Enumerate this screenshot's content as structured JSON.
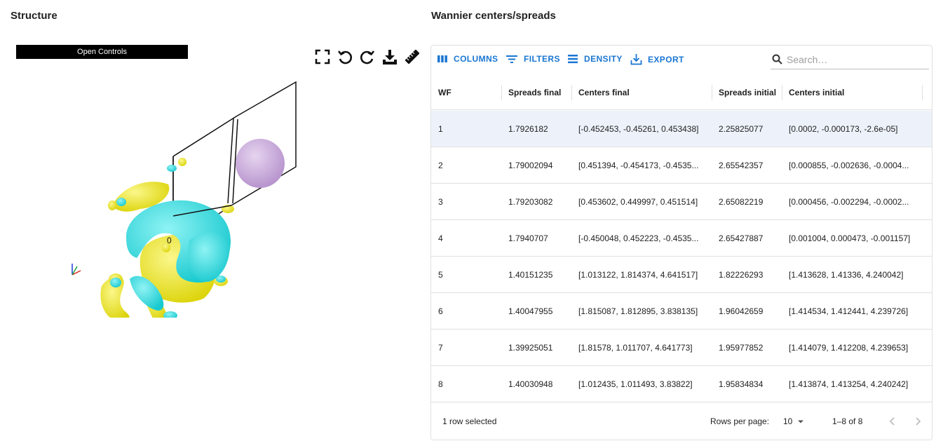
{
  "left": {
    "title": "Structure",
    "open_controls": "Open Controls",
    "axis_label": "0",
    "tools": [
      "fullscreen-icon",
      "rotate-left-icon",
      "rotate-right-icon",
      "download-icon",
      "ruler-icon"
    ]
  },
  "right": {
    "title": "Wannier centers/spreads",
    "toolbar": {
      "columns": "COLUMNS",
      "filters": "FILTERS",
      "density": "DENSITY",
      "export": "EXPORT",
      "search_placeholder": "Search…"
    },
    "columns": [
      "WF",
      "Spreads final",
      "Centers final",
      "Spreads initial",
      "Centers initial"
    ],
    "rows": [
      {
        "wf": "1",
        "sf": "1.7926182",
        "cf": "[-0.452453, -0.45261, 0.453438]",
        "si": "2.25825077",
        "ci": "[0.0002, -0.000173, -2.6e-05]"
      },
      {
        "wf": "2",
        "sf": "1.79002094",
        "cf": "[0.451394, -0.454173, -0.4535...",
        "si": "2.65542357",
        "ci": "[0.000855, -0.002636, -0.0004..."
      },
      {
        "wf": "3",
        "sf": "1.79203082",
        "cf": "[0.453602, 0.449997, 0.451514]",
        "si": "2.65082219",
        "ci": "[0.000456, -0.002294, -0.0002..."
      },
      {
        "wf": "4",
        "sf": "1.7940707",
        "cf": "[-0.450048, 0.452223, -0.4535...",
        "si": "2.65427887",
        "ci": "[0.001004, 0.000473, -0.001157]"
      },
      {
        "wf": "5",
        "sf": "1.40151235",
        "cf": "[1.013122, 1.814374, 4.641517]",
        "si": "1.82226293",
        "ci": "[1.413628, 1.41336, 4.240042]"
      },
      {
        "wf": "6",
        "sf": "1.40047955",
        "cf": "[1.815087, 1.812895, 3.838135]",
        "si": "1.96042659",
        "ci": "[1.414534, 1.412441, 4.239726]"
      },
      {
        "wf": "7",
        "sf": "1.39925051",
        "cf": "[1.81578, 1.011707, 4.641773]",
        "si": "1.95977852",
        "ci": "[1.414079, 1.412208, 4.239653]"
      },
      {
        "wf": "8",
        "sf": "1.40030948",
        "cf": "[1.012435, 1.011493, 3.83822]",
        "si": "1.95834834",
        "ci": "[1.413874, 1.413254, 4.240242]"
      }
    ],
    "selected_row": 0,
    "footer": {
      "selected": "1 row selected",
      "rows_per_page_label": "Rows per page:",
      "rows_per_page": "10",
      "page_info": "1–8 of 8"
    },
    "colors": {
      "accent": "#1976d2",
      "selected_row": "#edf2fa",
      "isosurface_positive": "#f0e811",
      "isosurface_negative": "#2ed8dc",
      "atom": "#c9a6dc"
    }
  }
}
